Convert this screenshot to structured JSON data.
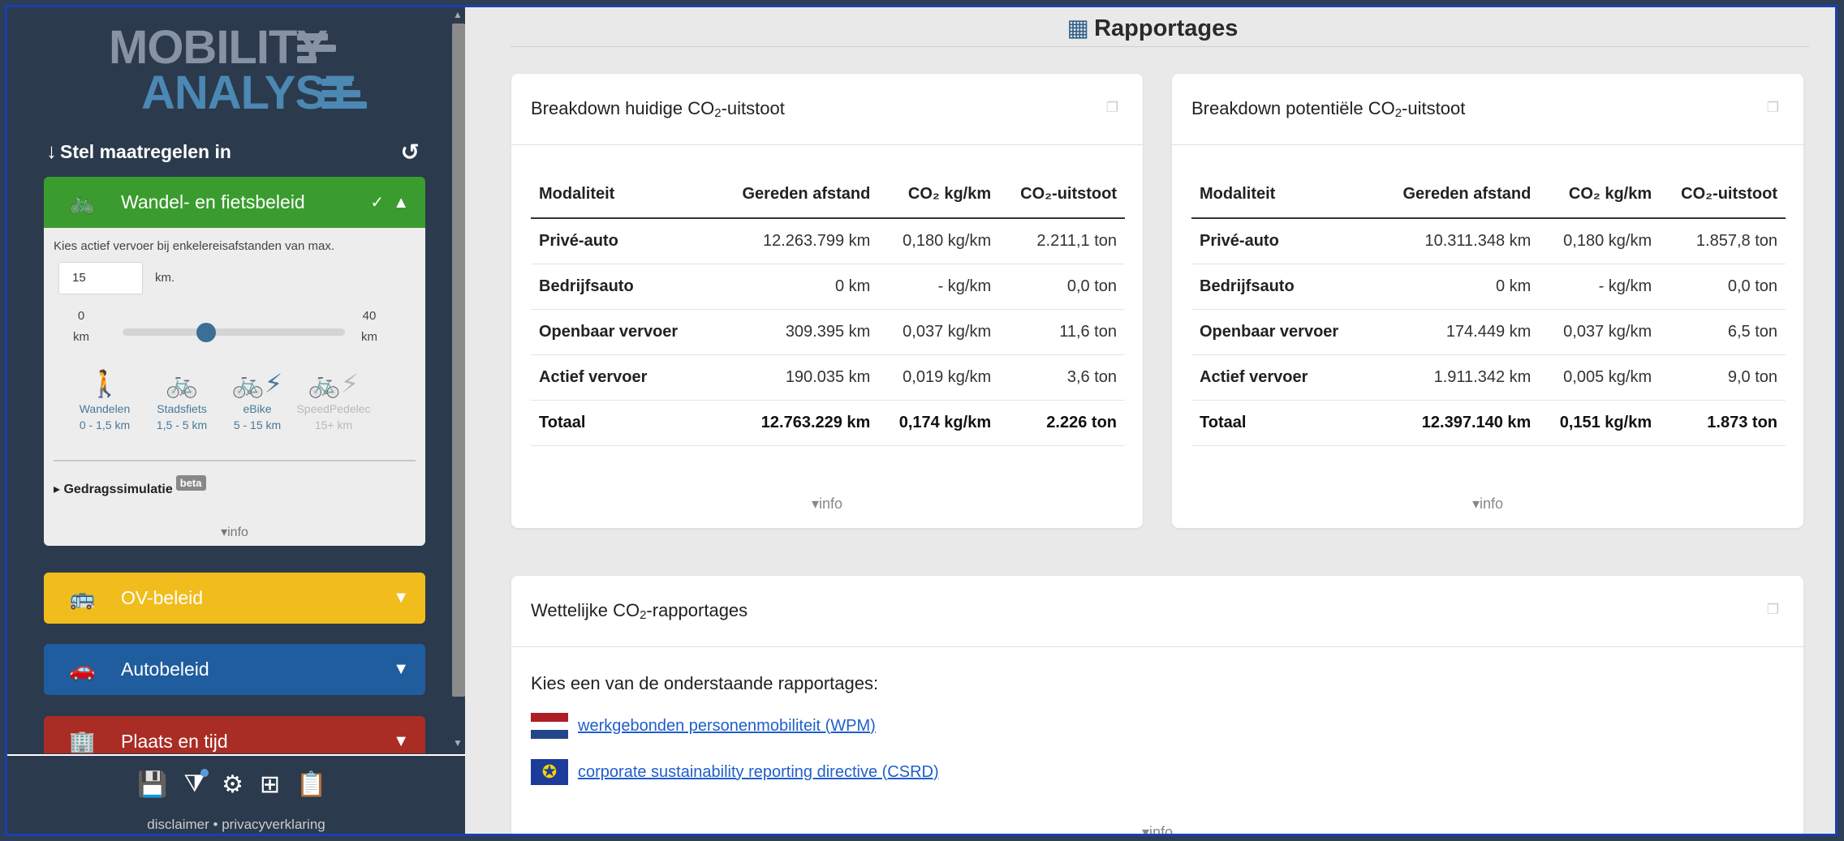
{
  "sidebar": {
    "logo": {
      "line1": "MOBILITY",
      "line2": "ANALYST"
    },
    "measures_heading": "Stel maatregelen in",
    "panels": {
      "bike": {
        "label": "Wandel- en fietsbeleid",
        "color": "#3a9c2e",
        "description": "Kies actief vervoer bij enkelereisafstanden van max.",
        "distance_value": "15",
        "distance_unit": "km.",
        "slider": {
          "min_value": "0",
          "min_unit": "km",
          "max_value": "40",
          "max_unit": "km",
          "current": 15,
          "min": 0,
          "max": 40
        },
        "modes": [
          {
            "icon": "walk-icon",
            "name": "Wandelen",
            "range": "0 - 1,5 km",
            "active": true
          },
          {
            "icon": "bike-icon",
            "name": "Stadsfiets",
            "range": "1,5 - 5 km",
            "active": true
          },
          {
            "icon": "ebike-icon",
            "name": "eBike",
            "range": "5 - 15 km",
            "active": true
          },
          {
            "icon": "speedpedelec-icon",
            "name": "SpeedPedelec",
            "range": "15+ km",
            "active": false
          }
        ],
        "behavior_sim": "Gedragssimulatie",
        "beta": "beta",
        "info": "info"
      },
      "ov": {
        "label": "OV-beleid",
        "color": "#f0bd1d"
      },
      "auto": {
        "label": "Autobeleid",
        "color": "#1f5d9e"
      },
      "place": {
        "label": "Plaats en tijd",
        "color": "#a92d24"
      }
    },
    "footer": {
      "disclaimer": "disclaimer",
      "separator": "•",
      "privacy": "privacyverklaring"
    }
  },
  "main": {
    "title": "Rapportages",
    "current": {
      "title_pre": "Breakdown huidige CO",
      "title_sub": "2",
      "title_post": "-uitstoot",
      "headers": [
        "Modaliteit",
        "Gereden afstand",
        "CO₂ kg/km",
        "CO₂-uitstoot"
      ],
      "rows": [
        [
          "Privé-auto",
          "12.263.799 km",
          "0,180 kg/km",
          "2.211,1 ton"
        ],
        [
          "Bedrijfsauto",
          "0 km",
          "- kg/km",
          "0,0 ton"
        ],
        [
          "Openbaar vervoer",
          "309.395 km",
          "0,037 kg/km",
          "11,6 ton"
        ],
        [
          "Actief vervoer",
          "190.035 km",
          "0,019 kg/km",
          "3,6 ton"
        ]
      ],
      "total": [
        "Totaal",
        "12.763.229 km",
        "0,174 kg/km",
        "2.226 ton"
      ],
      "info": "info"
    },
    "potential": {
      "title_pre": "Breakdown potentiële CO",
      "title_sub": "2",
      "title_post": "-uitstoot",
      "headers": [
        "Modaliteit",
        "Gereden afstand",
        "CO₂ kg/km",
        "CO₂-uitstoot"
      ],
      "rows": [
        [
          "Privé-auto",
          "10.311.348 km",
          "0,180 kg/km",
          "1.857,8 ton"
        ],
        [
          "Bedrijfsauto",
          "0 km",
          "- kg/km",
          "0,0 ton"
        ],
        [
          "Openbaar vervoer",
          "174.449 km",
          "0,037 kg/km",
          "6,5 ton"
        ],
        [
          "Actief vervoer",
          "1.911.342 km",
          "0,005 kg/km",
          "9,0 ton"
        ]
      ],
      "total": [
        "Totaal",
        "12.397.140 km",
        "0,151 kg/km",
        "1.873 ton"
      ],
      "info": "info"
    },
    "legal": {
      "title_pre": "Wettelijke CO",
      "title_sub": "2",
      "title_post": "-rapportages",
      "prompt": "Kies een van de onderstaande rapportages:",
      "links": [
        {
          "flag": "nl-flag-icon",
          "label": "werkgebonden personenmobiliteit (WPM)"
        },
        {
          "flag": "eu-flag-icon",
          "label": "corporate sustainability reporting directive (CSRD)"
        }
      ],
      "info": "info"
    }
  }
}
